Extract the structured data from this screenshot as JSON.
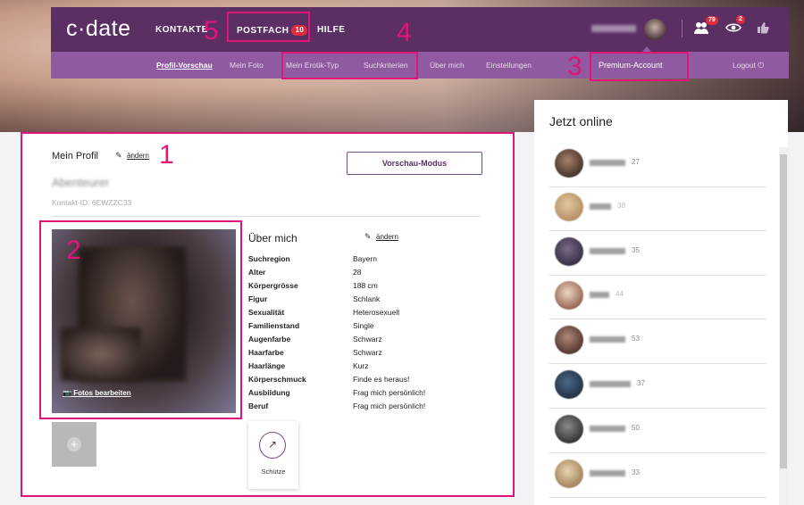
{
  "brand": {
    "logo": "c·date"
  },
  "topnav": {
    "kontakte": "KONTAKTE",
    "postfach": "POSTFACH",
    "postfach_count": "10",
    "hilfe": "HILFE",
    "contacts_count": "79",
    "visitors_count": "2",
    "icons": [
      "people-icon",
      "eye-icon",
      "thumbs-up-icon"
    ]
  },
  "subnav": {
    "items": [
      "Profil-Vorschau",
      "Mein Foto",
      "Mein Erotik-Typ",
      "Suchkriterien",
      "Über mich",
      "Einstellungen"
    ],
    "premium": "Premium-Account",
    "logout": "Logout"
  },
  "annotations": {
    "n1": "1",
    "n2": "2",
    "n3": "3",
    "n4": "4",
    "n5": "5",
    "color": "#e0157a"
  },
  "profile": {
    "title": "Mein Profil",
    "edit": "ändern",
    "username": "Abenteurer",
    "contact_id": "Kontakt-ID: 6EWZZC33",
    "preview_button": "Vorschau-Modus",
    "photo_edit": "Fotos bearbeiten",
    "about_title": "Über mich",
    "about_edit": "ändern",
    "details": [
      {
        "label": "Suchregion",
        "value": "Bayern"
      },
      {
        "label": "Alter",
        "value": "28"
      },
      {
        "label": "Körpergrösse",
        "value": "188 cm"
      },
      {
        "label": "Figur",
        "value": "Schlank"
      },
      {
        "label": "Sexualität",
        "value": "Heterosexuell"
      },
      {
        "label": "Familienstand",
        "value": "Single"
      },
      {
        "label": "Augenfarbe",
        "value": "Schwarz"
      },
      {
        "label": "Haarfarbe",
        "value": "Schwarz"
      },
      {
        "label": "Haarlänge",
        "value": "Kurz"
      },
      {
        "label": "Körperschmuck",
        "value": "Finde es heraus!"
      },
      {
        "label": "Ausbildung",
        "value": "Frag mich persönlich!"
      },
      {
        "label": "Beruf",
        "value": "Frag mich persönlich!"
      }
    ],
    "zodiac_label": "Schütze"
  },
  "online": {
    "title": "Jetzt online",
    "users": [
      {
        "age": "27"
      },
      {
        "age": "38"
      },
      {
        "age": "35"
      },
      {
        "age": "44"
      },
      {
        "age": "53"
      },
      {
        "age": "37"
      },
      {
        "age": "50"
      },
      {
        "age": "33"
      }
    ]
  },
  "colors": {
    "topbar": "#5b2f63",
    "subbar": "#8f5aa0",
    "highlight": "#e0157a",
    "badge": "#e02c3c"
  }
}
